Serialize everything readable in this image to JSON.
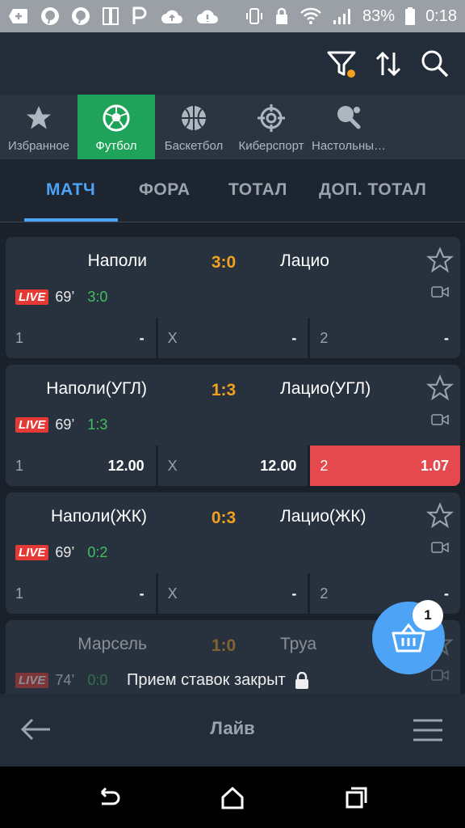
{
  "status_bar": {
    "battery": "83%",
    "time": "0:18",
    "left_icons": [
      "plus-icon",
      "pinterest-icon",
      "pinterest-icon",
      "book-icon",
      "p-icon",
      "cloud-upload-icon",
      "cloud-alert-icon"
    ],
    "right_icons": [
      "vibrate-icon",
      "lock-icon",
      "wifi-icon",
      "signal-icon"
    ]
  },
  "app_bar": {
    "icons": [
      "filter-icon",
      "sort-icon",
      "search-icon"
    ],
    "filter_dot_color": "#f3a01c"
  },
  "sports": [
    {
      "label": "Избранное",
      "icon": "star-icon",
      "active": false
    },
    {
      "label": "Футбол",
      "icon": "soccer-ball-icon",
      "active": true
    },
    {
      "label": "Баскетбол",
      "icon": "basketball-icon",
      "active": false
    },
    {
      "label": "Киберспорт",
      "icon": "crosshair-icon",
      "active": false
    },
    {
      "label": "Настольны…",
      "icon": "ping-pong-icon",
      "active": false
    }
  ],
  "tabs": [
    {
      "label": "МАТЧ",
      "active": true
    },
    {
      "label": "ФОРА",
      "active": false
    },
    {
      "label": "ТОТАЛ",
      "active": false
    },
    {
      "label": "ДОП. ТОТАЛ",
      "active": false
    }
  ],
  "matches": [
    {
      "team1": "Наполи",
      "team2": "Лацио",
      "score": "3:0",
      "live": "LIVE",
      "minute": "69’",
      "current": "3:0",
      "odds": [
        {
          "label": "1",
          "value": "-"
        },
        {
          "label": "X",
          "value": "-"
        },
        {
          "label": "2",
          "value": "-"
        }
      ]
    },
    {
      "team1": "Наполи(УГЛ)",
      "team2": "Лацио(УГЛ)",
      "score": "1:3",
      "live": "LIVE",
      "minute": "69’",
      "current": "1:3",
      "odds": [
        {
          "label": "1",
          "value": "12.00"
        },
        {
          "label": "X",
          "value": "12.00"
        },
        {
          "label": "2",
          "value": "1.07"
        }
      ]
    },
    {
      "team1": "Наполи(ЖК)",
      "team2": "Лацио(ЖК)",
      "score": "0:3",
      "live": "LIVE",
      "minute": "69’",
      "current": "0:2",
      "odds": [
        {
          "label": "1",
          "value": "-"
        },
        {
          "label": "X",
          "value": "-"
        },
        {
          "label": "2",
          "value": "-"
        }
      ]
    },
    {
      "team1": "Марсель",
      "team2": "Труа",
      "score": "1:0",
      "live": "LIVE",
      "minute": "74’",
      "current": "0:0",
      "closed_text": "Прием ставок закрыт"
    }
  ],
  "betslip": {
    "count": "1"
  },
  "bottom_bar": {
    "title": "Лайв"
  },
  "colors": {
    "accent": "#4da3f5",
    "active_sport": "#1fa25a",
    "score": "#f3a01c",
    "live": "#e53935",
    "highlight_odd": "#e5484d"
  }
}
